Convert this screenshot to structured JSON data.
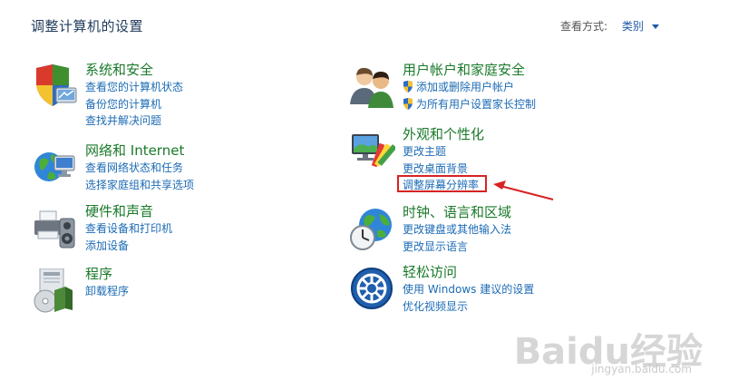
{
  "header": {
    "title": "调整计算机的设置",
    "view_by_label": "查看方式:",
    "view_by_value": "类别"
  },
  "categories": [
    {
      "id": "system-security",
      "title": "系统和安全",
      "icon": "shield-monitor-icon",
      "links": [
        "查看您的计算机状态",
        "备份您的计算机",
        "查找并解决问题"
      ]
    },
    {
      "id": "network-internet",
      "title": "网络和 Internet",
      "icon": "network-globe-icon",
      "links": [
        "查看网络状态和任务",
        "选择家庭组和共享选项"
      ]
    },
    {
      "id": "hardware-sound",
      "title": "硬件和声音",
      "icon": "printer-speaker-icon",
      "links": [
        "查看设备和打印机",
        "添加设备"
      ]
    },
    {
      "id": "programs",
      "title": "程序",
      "icon": "programs-disc-icon",
      "links": [
        "卸载程序"
      ]
    },
    {
      "id": "user-accounts",
      "title": "用户帐户和家庭安全",
      "icon": "users-icon",
      "links": [
        "添加或删除用户帐户",
        "为所有用户设置家长控制"
      ]
    },
    {
      "id": "appearance",
      "title": "外观和个性化",
      "icon": "monitor-palette-icon",
      "links": [
        "更改主题",
        "更改桌面背景",
        "调整屏幕分辨率"
      ]
    },
    {
      "id": "clock-region",
      "title": "时钟、语言和区域",
      "icon": "clock-globe-icon",
      "links": [
        "更改键盘或其他输入法",
        "更改显示语言"
      ]
    },
    {
      "id": "ease-access",
      "title": "轻松访问",
      "icon": "ease-of-access-icon",
      "links": [
        "使用 Windows 建议的设置",
        "优化视频显示"
      ]
    }
  ],
  "annotation": {
    "highlight_color": "#d72323",
    "arrow_color": "#d72323"
  },
  "watermark": {
    "main": "Baidu经验",
    "sub": "jingyan.baidu.com"
  },
  "colors": {
    "title_green": "#1a7a2a",
    "link_blue": "#1c6bb5",
    "header_blue": "#1e395b"
  }
}
